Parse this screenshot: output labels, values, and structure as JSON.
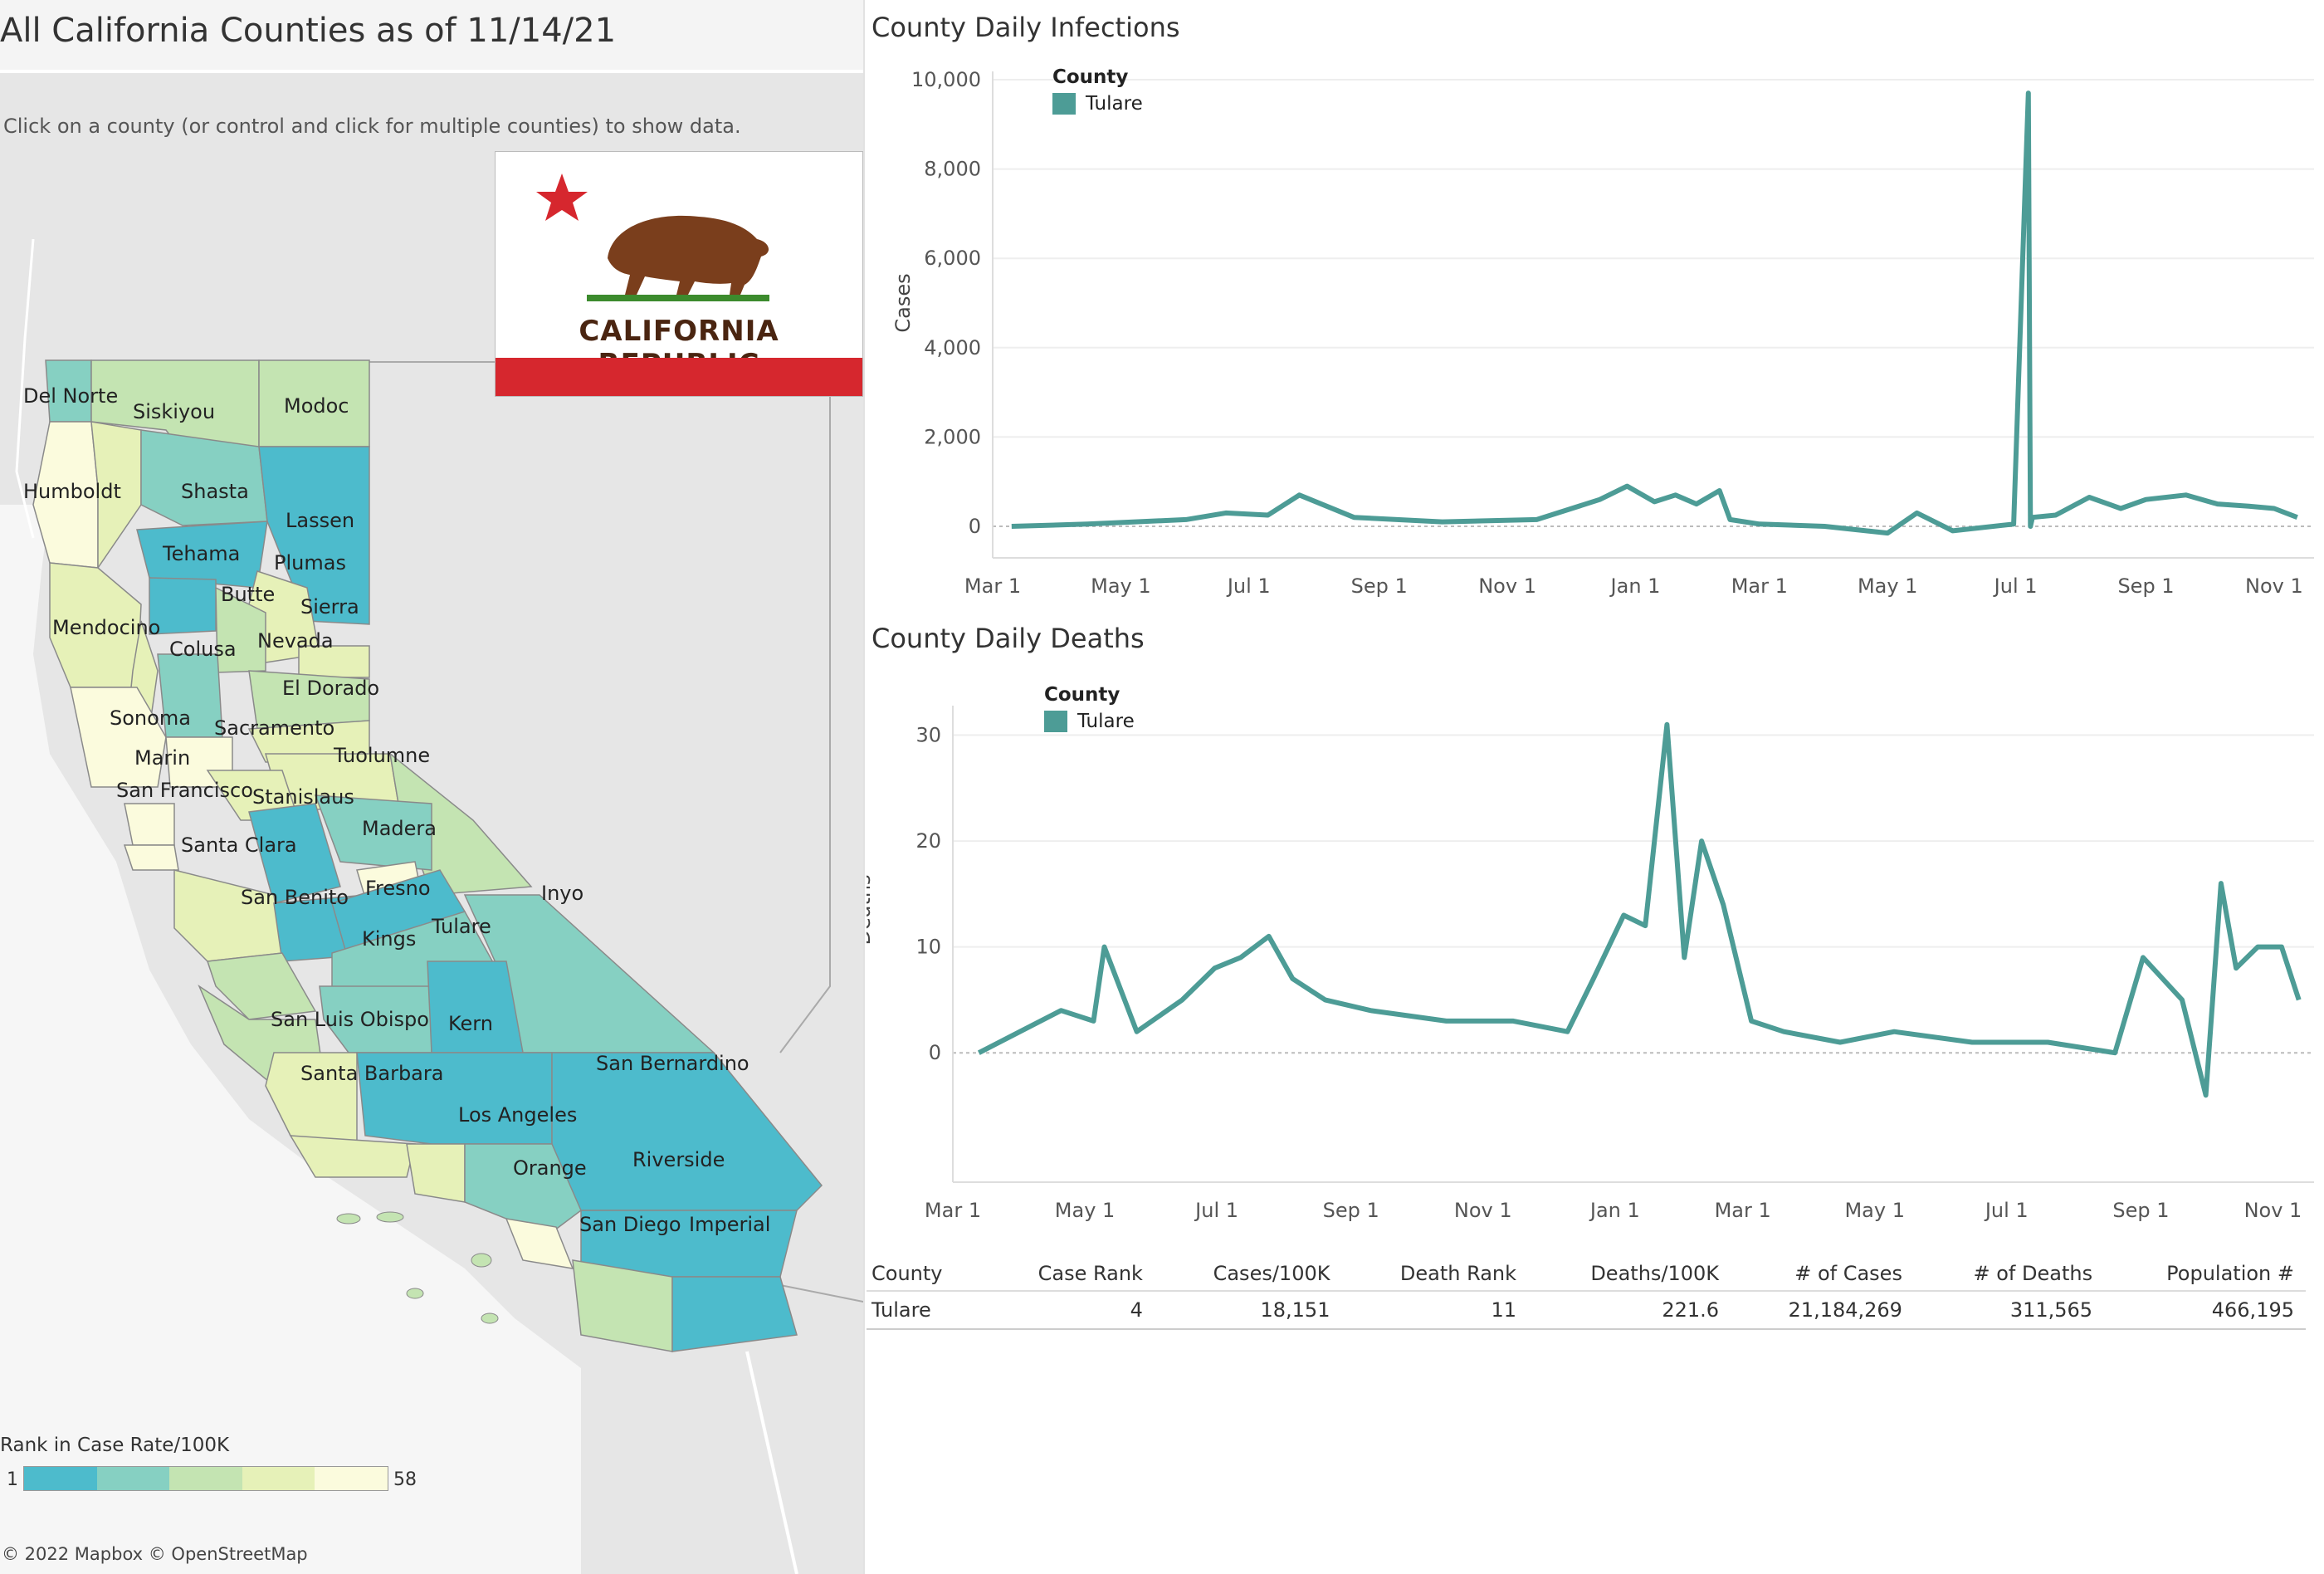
{
  "dashboard": {
    "title": "All California Counties as of 11/14/21",
    "instructions": "Click on a county (or control and click for multiple counties) to show data."
  },
  "map": {
    "flag_text": "CALIFORNIA REPUBLIC",
    "counties": [
      "Del Norte",
      "Siskiyou",
      "Modoc",
      "Humboldt",
      "Shasta",
      "Lassen",
      "Tehama",
      "Plumas",
      "Butte",
      "Sierra",
      "Mendocino",
      "Colusa",
      "Nevada",
      "El Dorado",
      "Sonoma",
      "Sacramento",
      "Marin",
      "Tuolumne",
      "San Francisco",
      "Stanislaus",
      "Santa Clara",
      "Madera",
      "Fresno",
      "Inyo",
      "San Benito",
      "Tulare",
      "Kings",
      "San Luis Obispo",
      "Kern",
      "San Bernardino",
      "Santa Barbara",
      "Los Angeles",
      "Orange",
      "Riverside",
      "San Diego",
      "Imperial"
    ],
    "legend": {
      "title": "Rank in Case Rate/100K",
      "min": "1",
      "max": "58",
      "colors": [
        "#4dbbcc",
        "#86d0c2",
        "#c4e4b2",
        "#e6f1b8",
        "#fbfbdd"
      ]
    },
    "attribution": "© 2022 Mapbox © OpenStreetMap"
  },
  "infections_chart": {
    "title": "County Daily Infections",
    "ylabel": "Cases",
    "legend_title": "County",
    "legend_item": "Tulare",
    "line_color": "#4d9c96",
    "y_ticks": [
      "0",
      "2,000",
      "4,000",
      "6,000",
      "8,000",
      "10,000"
    ],
    "x_ticks": [
      "Mar 1",
      "May 1",
      "Jul 1",
      "Sep 1",
      "Nov 1",
      "Jan 1",
      "Mar 1",
      "May 1",
      "Jul 1",
      "Sep 1",
      "Nov 1"
    ]
  },
  "deaths_chart": {
    "title": "County Daily Deaths",
    "ylabel": "Deaths",
    "legend_title": "County",
    "legend_item": "Tulare",
    "line_color": "#4d9c96",
    "y_ticks": [
      "0",
      "10",
      "20",
      "30"
    ],
    "x_ticks": [
      "Mar 1",
      "May 1",
      "Jul 1",
      "Sep 1",
      "Nov 1",
      "Jan 1",
      "Mar 1",
      "May 1",
      "Jul 1",
      "Sep 1",
      "Nov 1"
    ]
  },
  "chart_data": [
    {
      "type": "line",
      "title": "County Daily Infections",
      "xlabel": "",
      "ylabel": "Cases",
      "ylim": [
        0,
        10000
      ],
      "grid": true,
      "legend_placement": "top-left",
      "series": [
        {
          "name": "Tulare",
          "x": [
            "2020-03-10",
            "2020-04-15",
            "2020-06-01",
            "2020-06-20",
            "2020-07-10",
            "2020-07-25",
            "2020-08-20",
            "2020-10-01",
            "2020-11-15",
            "2020-12-15",
            "2020-12-28",
            "2021-01-10",
            "2021-01-20",
            "2021-01-30",
            "2021-02-10",
            "2021-02-15",
            "2021-03-01",
            "2021-04-01",
            "2021-05-01",
            "2021-05-15",
            "2021-06-01",
            "2021-06-30",
            "2021-07-07",
            "2021-07-08",
            "2021-07-09",
            "2021-07-20",
            "2021-08-05",
            "2021-08-20",
            "2021-09-01",
            "2021-09-20",
            "2021-10-05",
            "2021-10-20",
            "2021-11-01",
            "2021-11-12"
          ],
          "values": [
            0,
            50,
            150,
            300,
            250,
            700,
            200,
            100,
            150,
            600,
            900,
            550,
            700,
            500,
            800,
            150,
            50,
            0,
            -150,
            300,
            -100,
            50,
            9700,
            0,
            200,
            250,
            650,
            400,
            600,
            700,
            500,
            450,
            400,
            200
          ]
        }
      ]
    },
    {
      "type": "line",
      "title": "County Daily Deaths",
      "xlabel": "",
      "ylabel": "Deaths",
      "ylim": [
        -5,
        32
      ],
      "grid": true,
      "legend_placement": "top-left",
      "series": [
        {
          "name": "Tulare",
          "x": [
            "2020-03-13",
            "2020-04-01",
            "2020-04-20",
            "2020-05-05",
            "2020-05-10",
            "2020-05-25",
            "2020-06-15",
            "2020-06-30",
            "2020-07-12",
            "2020-07-25",
            "2020-08-05",
            "2020-08-20",
            "2020-09-10",
            "2020-10-15",
            "2020-11-15",
            "2020-12-10",
            "2020-12-22",
            "2021-01-05",
            "2021-01-15",
            "2021-01-25",
            "2021-02-02",
            "2021-02-10",
            "2021-02-20",
            "2021-03-05",
            "2021-03-20",
            "2021-04-15",
            "2021-05-10",
            "2021-06-15",
            "2021-07-20",
            "2021-08-20",
            "2021-09-02",
            "2021-09-20",
            "2021-10-01",
            "2021-10-08",
            "2021-10-15",
            "2021-10-25",
            "2021-11-05",
            "2021-11-13"
          ],
          "values": [
            0,
            2,
            4,
            3,
            10,
            2,
            5,
            8,
            9,
            11,
            7,
            5,
            4,
            3,
            3,
            2,
            7,
            13,
            12,
            31,
            9,
            20,
            14,
            3,
            2,
            1,
            2,
            1,
            1,
            0,
            9,
            5,
            -4,
            16,
            8,
            10,
            10,
            5
          ]
        }
      ]
    }
  ],
  "table": {
    "headers": [
      "County",
      "Case Rank",
      "Cases/100K",
      "Death Rank",
      "Deaths/100K",
      "# of Cases",
      "# of Deaths",
      "Population #"
    ],
    "rows": [
      [
        "Tulare",
        "4",
        "18,151",
        "11",
        "221.6",
        "21,184,269",
        "311,565",
        "466,195"
      ]
    ]
  }
}
